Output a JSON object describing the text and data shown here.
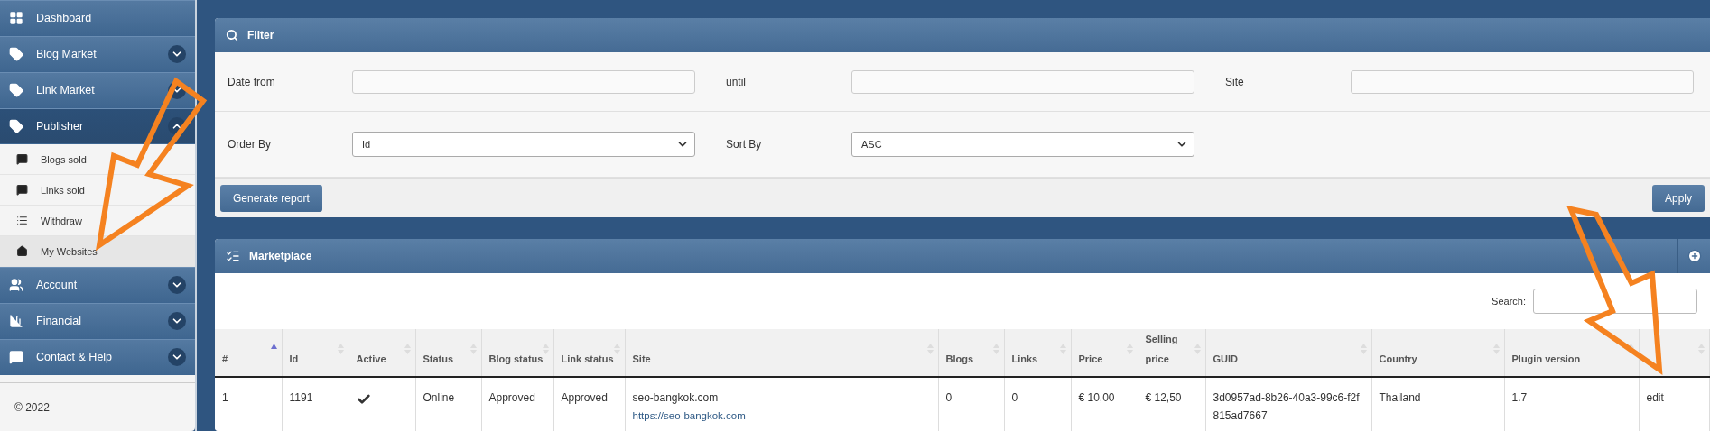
{
  "sidebar": {
    "items": [
      {
        "label": "Dashboard"
      },
      {
        "label": "Blog Market",
        "expanded": false
      },
      {
        "label": "Link Market",
        "expanded": false
      },
      {
        "label": "Publisher",
        "expanded": true,
        "children": [
          {
            "label": "Blogs sold",
            "selected": false
          },
          {
            "label": "Links sold",
            "selected": false
          },
          {
            "label": "Withdraw",
            "selected": false
          },
          {
            "label": "My Websites",
            "selected": true
          }
        ]
      },
      {
        "label": "Account",
        "expanded": false
      },
      {
        "label": "Financial",
        "expanded": false
      },
      {
        "label": "Contact & Help",
        "expanded": false
      }
    ],
    "footer": "© 2022"
  },
  "filter": {
    "title": "Filter",
    "rows": [
      [
        {
          "label": "Date from",
          "kind": "input"
        },
        {
          "label": "until",
          "kind": "input"
        },
        {
          "label": "Site",
          "kind": "input"
        }
      ],
      [
        {
          "label": "Order By",
          "kind": "select",
          "value": "Id"
        },
        {
          "label": "Sort By",
          "kind": "select",
          "value": "ASC"
        }
      ]
    ],
    "buttons": [
      "Generate report",
      "Apply"
    ]
  },
  "marketplace": {
    "title": "Marketplace",
    "search_label": "Search:",
    "columns": [
      {
        "label": "#",
        "sorted": true
      },
      {
        "label": "Id",
        "sorted": false
      },
      {
        "label": "Active",
        "sorted": false
      },
      {
        "label": "Status",
        "sorted": false
      },
      {
        "label": "Blog status",
        "sorted": false
      },
      {
        "label": "Link status",
        "sorted": false
      },
      {
        "label": "Site",
        "sorted": false
      },
      {
        "label": "Blogs",
        "sorted": false
      },
      {
        "label": "Links",
        "sorted": false
      },
      {
        "label": "Price",
        "sorted": false
      },
      {
        "label": "Selling price",
        "sorted": false
      },
      {
        "label": "GUID",
        "sorted": false
      },
      {
        "label": "Country",
        "sorted": false
      },
      {
        "label": "Plugin version",
        "sorted": false
      },
      {
        "sorted": false
      }
    ],
    "rows": [
      {
        "index": "1",
        "id": "1191",
        "active": true,
        "status": "Online",
        "blog_status": "Approved",
        "link_status": "Approved",
        "site": "seo-bangkok.com",
        "site_url": "https://seo-bangkok.com",
        "blogs": "0",
        "links": "0",
        "price": "€ 10,00",
        "selling_price": "€ 12,50",
        "guid": "3d0957ad-8b26-40a3-99c6-f2f815ad7667",
        "country": "Thailand",
        "plugin_version": "1.7",
        "action": "edit"
      }
    ]
  }
}
